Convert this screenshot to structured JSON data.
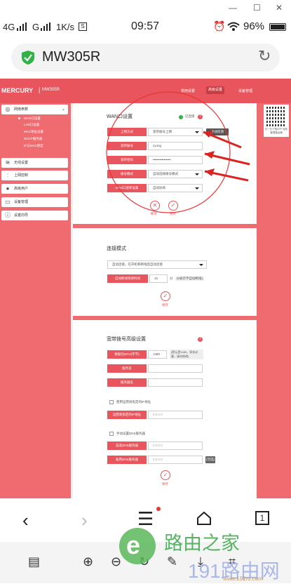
{
  "system_status": {
    "network_label": "4G",
    "carrier": "G",
    "speed": "1K/s",
    "time": "09:57",
    "battery": "96%"
  },
  "browser": {
    "page_title": "MW305R"
  },
  "router": {
    "brand": "MERCURY",
    "model": "MW305R",
    "top_nav": [
      "常用设置",
      "高级设置",
      "设备管理"
    ],
    "sidebar_items": [
      "网络参数",
      "无线设置",
      "上网控制",
      "高级用户",
      "设备管理",
      "设置向导"
    ],
    "submenu": [
      "WAN口设置",
      "LAN口设置",
      "MAC地址设置",
      "DHCP服务器",
      "IP与MAC绑定"
    ],
    "qr_caption": "扫一扫下载APP 轻松管理路由器",
    "wan": {
      "title": "WAN口设置",
      "status": "已连接",
      "connection_type_label": "上网方式",
      "connection_type_value": "宽带拨号上网",
      "detect_button": "手动检测",
      "account_label": "宽带账号",
      "account_value": "zyong",
      "password_label": "宽带密码",
      "password_value": "••••••••••••••••",
      "dial_mode_label": "拨号模式",
      "dial_mode_value": "自动选择拨号模式",
      "wan_rate_label": "WAN口速率设置",
      "wan_rate_value": "自动协商",
      "disconnect_label": "断开",
      "save_label": "保存"
    },
    "connect_mode": {
      "title": "连接模式",
      "mode_value": "自动连接，在开机和断线后自动连接",
      "idle_label": "自动断线等待时间",
      "idle_value": "15",
      "idle_unit": "分",
      "idle_note": "(0表示不自动断线)",
      "save_label": "保存"
    },
    "advanced": {
      "title": "宽带拨号高级设置",
      "mtu_label": "数据包MTU(字节)",
      "mtu_value": "1480",
      "mtu_note": "(默认是1480，如非必要，请勿修改)",
      "service_label": "服务名",
      "server_label": "服务器名",
      "use_ip_label": "使用运营商指定的IP地址",
      "ip_label": "运营商指定的IP地址",
      "ip_placeholder": "0.0.0.0",
      "dns_check_label": "手动设置DNS服务器",
      "dns1_label": "首选DNS服务器",
      "dns1_placeholder": "0.0.0.0",
      "dns2_label": "备用DNS服务器",
      "dns2_placeholder": "0.0.0.0",
      "dns2_note": "(可选)",
      "save_label": "保存"
    }
  },
  "bottom_nav": {
    "tab_count": "1"
  },
  "watermark": {
    "brand": "路由之家",
    "site": "191路由网",
    "url": "www.191ru.com"
  },
  "colors": {
    "accent": "#e8555c",
    "accent_light": "#f06b70",
    "secure_green": "#2fb344",
    "watermark_green": "#5cb85c",
    "watermark_blue": "#a9b8e8"
  }
}
